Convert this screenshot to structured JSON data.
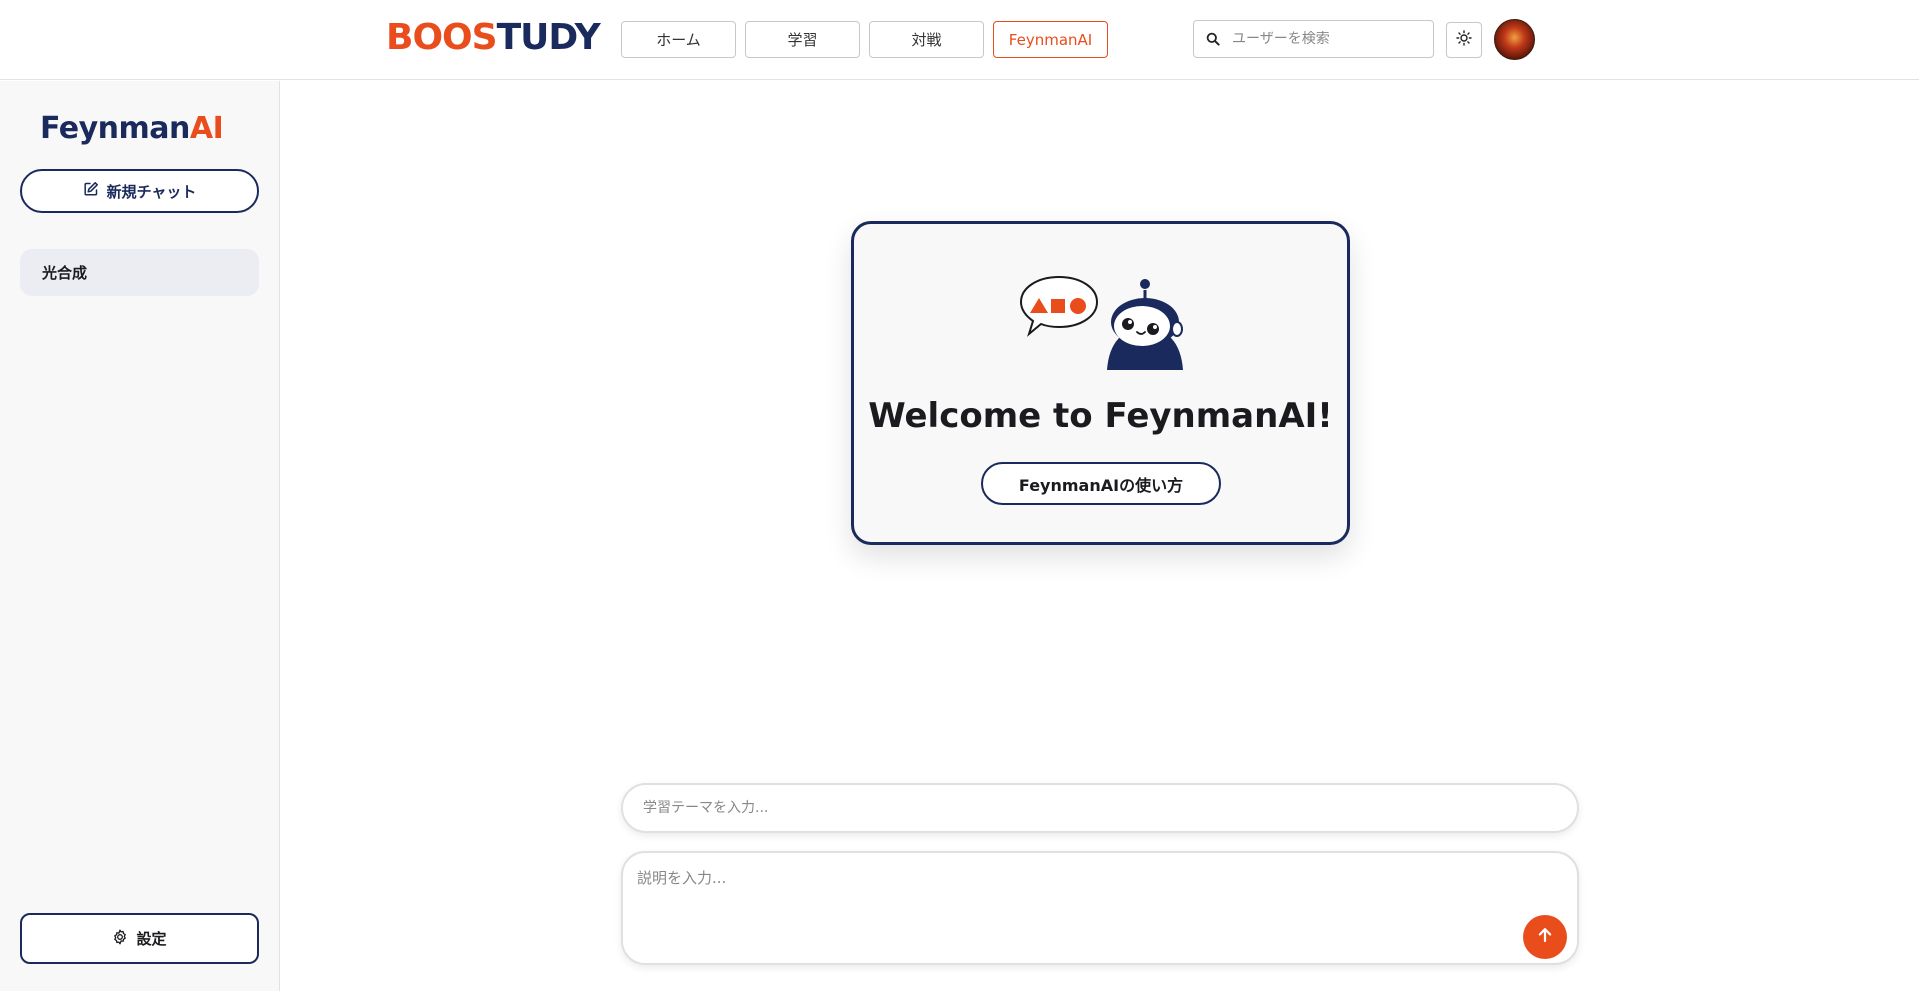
{
  "header": {
    "logo": {
      "part1": "BOOS",
      "part2": "TUDY"
    },
    "nav": [
      {
        "label": "ホーム"
      },
      {
        "label": "学習"
      },
      {
        "label": "対戦"
      },
      {
        "label": "FeynmanAI"
      }
    ],
    "search": {
      "placeholder": "ユーザーを検索",
      "icon": "search-icon"
    },
    "theme_toggle_icon": "sun-icon",
    "active_nav": "FeynmanAI"
  },
  "sidebar": {
    "logo": {
      "part1": "Feynman",
      "part2": "AI"
    },
    "new_chat_label": "新規チャット",
    "history": [
      {
        "label": "光合成"
      }
    ],
    "settings_label": "設定"
  },
  "main": {
    "welcome_title": "Welcome to FeynmanAI!",
    "howto_label": "FeynmanAIの使い方",
    "topic_placeholder": "学習テーマを入力...",
    "description_placeholder": "説明を入力...",
    "send_icon": "arrow-up-icon"
  },
  "colors": {
    "accent": "#ea4d1c",
    "navy": "#1a2a5c",
    "sidebar_bg": "#f8f8f8"
  }
}
